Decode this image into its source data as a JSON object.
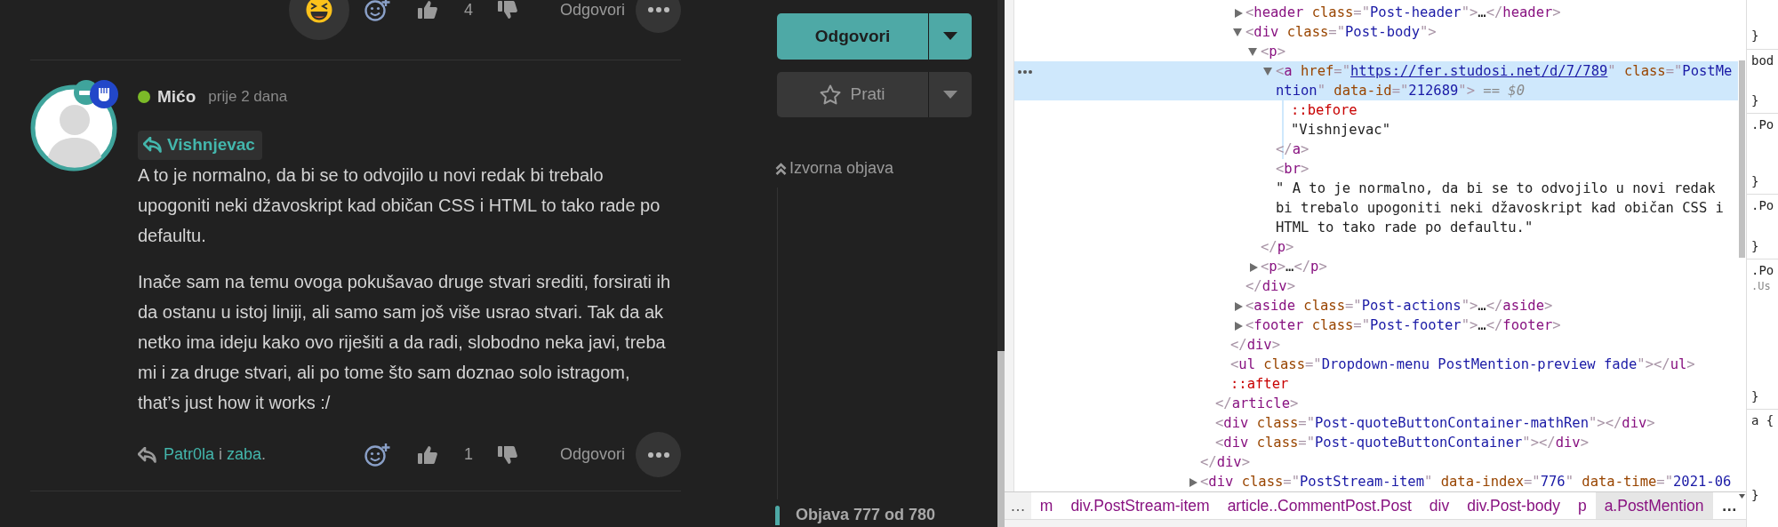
{
  "previous_post_footer": {
    "likes_count": "4",
    "reply_label": "Odgovori"
  },
  "post": {
    "author": "Mićo",
    "online": true,
    "time": "prije 2 dana",
    "mention": "Vishnjevac",
    "paragraphs": [
      "A to je normalno, da bi se to odvojilo u novi redak bi trebalo upogoniti neki džavoskript kad običan CSS i HTML to tako rade po defaultu.",
      "Inače sam na temu ovoga pokušavao druge stvari srediti, forsirati ih da ostanu u istoj liniji, ali samo sam još više usrao stvari. Tak da ak netko ima ideju kako ovo riješiti a da radi, slobodno neka javi, treba mi i za druge stvari, ali po tome što sam doznao solo istragom, that’s just how it works :/"
    ],
    "liked_by": [
      {
        "kind": "link",
        "text": "Patr0la"
      },
      {
        "kind": "text",
        "text": " i "
      },
      {
        "kind": "link",
        "text": "zaba"
      },
      {
        "kind": "text",
        "text": "."
      }
    ],
    "likes_count": "1",
    "reply_label": "Odgovori"
  },
  "sidebar": {
    "reply_button": "Odgovori",
    "follow_button": "Prati",
    "original_post_link": "Izvorna objava",
    "position": "Objava 777 od 780"
  },
  "devtools": {
    "tree": [
      {
        "children": [
          {
            "children": [
              {
                "children": [
                  {
                    "expanded": false,
                    "selected": false,
                    "open": [
                      {
                        "kind": "punct",
                        "text": "<"
                      },
                      {
                        "kind": "tag",
                        "text": "header"
                      },
                      {
                        "kind": "attr",
                        "text": " class"
                      },
                      {
                        "kind": "punct",
                        "text": "=\""
                      },
                      {
                        "kind": "value",
                        "text": "Post-header"
                      },
                      {
                        "kind": "punct",
                        "text": "\">"
                      },
                      {
                        "kind": "text",
                        "text": "…"
                      },
                      {
                        "kind": "punct",
                        "text": "</"
                      },
                      {
                        "kind": "tag",
                        "text": "header"
                      },
                      {
                        "kind": "punct",
                        "text": ">"
                      }
                    ]
                  },
                  {
                    "expanded": true,
                    "selected": false,
                    "open": [
                      {
                        "kind": "punct",
                        "text": "<"
                      },
                      {
                        "kind": "tag",
                        "text": "div"
                      },
                      {
                        "kind": "attr",
                        "text": " class"
                      },
                      {
                        "kind": "punct",
                        "text": "=\""
                      },
                      {
                        "kind": "value",
                        "text": "Post-body"
                      },
                      {
                        "kind": "punct",
                        "text": "\">"
                      }
                    ],
                    "children": [
                      {
                        "expanded": true,
                        "selected": false,
                        "open": [
                          {
                            "kind": "punct",
                            "text": "<"
                          },
                          {
                            "kind": "tag",
                            "text": "p"
                          },
                          {
                            "kind": "punct",
                            "text": ">"
                          }
                        ],
                        "children": [
                          {
                            "expanded": true,
                            "selected": true,
                            "open": [
                              {
                                "kind": "punct",
                                "text": "<"
                              },
                              {
                                "kind": "tag",
                                "text": "a"
                              },
                              {
                                "kind": "attr",
                                "text": " href"
                              },
                              {
                                "kind": "punct",
                                "text": "=\""
                              },
                              {
                                "kind": "link",
                                "text": "https://fer.studosi.net/d/7/789"
                              },
                              {
                                "kind": "punct",
                                "text": "\""
                              },
                              {
                                "kind": "attr",
                                "text": " class"
                              },
                              {
                                "kind": "punct",
                                "text": "=\""
                              },
                              {
                                "kind": "value",
                                "text": "PostMention"
                              },
                              {
                                "kind": "punct",
                                "text": "\""
                              },
                              {
                                "kind": "attr",
                                "text": " data-id"
                              },
                              {
                                "kind": "punct",
                                "text": "=\""
                              },
                              {
                                "kind": "value",
                                "text": "212689"
                              },
                              {
                                "kind": "punct",
                                "text": "\">"
                              }
                            ],
                            "ref": "== $0",
                            "children": [
                              {
                                "selected": false,
                                "open": [
                                  {
                                    "kind": "pseudo",
                                    "text": "::before"
                                  }
                                ]
                              },
                              {
                                "selected": false,
                                "open": [
                                  {
                                    "kind": "text",
                                    "text": "\"Vishnjevac\""
                                  }
                                ]
                              }
                            ],
                            "close": [
                              {
                                "kind": "punct",
                                "text": "</"
                              },
                              {
                                "kind": "tag",
                                "text": "a"
                              },
                              {
                                "kind": "punct",
                                "text": ">"
                              }
                            ]
                          },
                          {
                            "selected": false,
                            "open": [
                              {
                                "kind": "punct",
                                "text": "<"
                              },
                              {
                                "kind": "tag",
                                "text": "br"
                              },
                              {
                                "kind": "punct",
                                "text": ">"
                              }
                            ]
                          },
                          {
                            "selected": false,
                            "open": [
                              {
                                "kind": "text",
                                "text": "\" A to je normalno, da bi se to odvojilo u novi redak bi trebalo upogoniti neki džavoskript kad običan CSS i HTML to tako rade po defaultu.\""
                              }
                            ]
                          }
                        ],
                        "close": [
                          {
                            "kind": "punct",
                            "text": "</"
                          },
                          {
                            "kind": "tag",
                            "text": "p"
                          },
                          {
                            "kind": "punct",
                            "text": ">"
                          }
                        ]
                      },
                      {
                        "expanded": false,
                        "selected": false,
                        "open": [
                          {
                            "kind": "punct",
                            "text": "<"
                          },
                          {
                            "kind": "tag",
                            "text": "p"
                          },
                          {
                            "kind": "punct",
                            "text": ">"
                          },
                          {
                            "kind": "text",
                            "text": "…"
                          },
                          {
                            "kind": "punct",
                            "text": "</"
                          },
                          {
                            "kind": "tag",
                            "text": "p"
                          },
                          {
                            "kind": "punct",
                            "text": ">"
                          }
                        ]
                      }
                    ],
                    "close": [
                      {
                        "kind": "punct",
                        "text": "</"
                      },
                      {
                        "kind": "tag",
                        "text": "div"
                      },
                      {
                        "kind": "punct",
                        "text": ">"
                      }
                    ]
                  },
                  {
                    "expanded": false,
                    "selected": false,
                    "open": [
                      {
                        "kind": "punct",
                        "text": "<"
                      },
                      {
                        "kind": "tag",
                        "text": "aside"
                      },
                      {
                        "kind": "attr",
                        "text": " class"
                      },
                      {
                        "kind": "punct",
                        "text": "=\""
                      },
                      {
                        "kind": "value",
                        "text": "Post-actions"
                      },
                      {
                        "kind": "punct",
                        "text": "\">"
                      },
                      {
                        "kind": "text",
                        "text": "…"
                      },
                      {
                        "kind": "punct",
                        "text": "</"
                      },
                      {
                        "kind": "tag",
                        "text": "aside"
                      },
                      {
                        "kind": "punct",
                        "text": ">"
                      }
                    ]
                  },
                  {
                    "expanded": false,
                    "selected": false,
                    "open": [
                      {
                        "kind": "punct",
                        "text": "<"
                      },
                      {
                        "kind": "tag",
                        "text": "footer"
                      },
                      {
                        "kind": "attr",
                        "text": " class"
                      },
                      {
                        "kind": "punct",
                        "text": "=\""
                      },
                      {
                        "kind": "value",
                        "text": "Post-footer"
                      },
                      {
                        "kind": "punct",
                        "text": "\">"
                      },
                      {
                        "kind": "text",
                        "text": "…"
                      },
                      {
                        "kind": "punct",
                        "text": "</"
                      },
                      {
                        "kind": "tag",
                        "text": "footer"
                      },
                      {
                        "kind": "punct",
                        "text": ">"
                      }
                    ]
                  }
                ],
                "close": [
                  {
                    "kind": "punct",
                    "text": "</"
                  },
                  {
                    "kind": "tag",
                    "text": "div"
                  },
                  {
                    "kind": "punct",
                    "text": ">"
                  }
                ]
              },
              {
                "selected": false,
                "open": [
                  {
                    "kind": "punct",
                    "text": "<"
                  },
                  {
                    "kind": "tag",
                    "text": "ul"
                  },
                  {
                    "kind": "attr",
                    "text": " class"
                  },
                  {
                    "kind": "punct",
                    "text": "=\""
                  },
                  {
                    "kind": "value",
                    "text": "Dropdown-menu PostMention-preview fade"
                  },
                  {
                    "kind": "punct",
                    "text": "\"></"
                  },
                  {
                    "kind": "tag",
                    "text": "ul"
                  },
                  {
                    "kind": "punct",
                    "text": ">"
                  }
                ]
              },
              {
                "selected": false,
                "open": [
                  {
                    "kind": "pseudo",
                    "text": "::after"
                  }
                ]
              }
            ],
            "close": [
              {
                "kind": "punct",
                "text": "</"
              },
              {
                "kind": "tag",
                "text": "article"
              },
              {
                "kind": "punct",
                "text": ">"
              }
            ]
          },
          {
            "selected": false,
            "open": [
              {
                "kind": "punct",
                "text": "<"
              },
              {
                "kind": "tag",
                "text": "div"
              },
              {
                "kind": "attr",
                "text": " class"
              },
              {
                "kind": "punct",
                "text": "=\""
              },
              {
                "kind": "value",
                "text": "Post-quoteButtonContainer-mathRen"
              },
              {
                "kind": "punct",
                "text": "\"></"
              },
              {
                "kind": "tag",
                "text": "div"
              },
              {
                "kind": "punct",
                "text": ">"
              }
            ]
          },
          {
            "selected": false,
            "open": [
              {
                "kind": "punct",
                "text": "<"
              },
              {
                "kind": "tag",
                "text": "div"
              },
              {
                "kind": "attr",
                "text": " class"
              },
              {
                "kind": "punct",
                "text": "=\""
              },
              {
                "kind": "value",
                "text": "Post-quoteButtonContainer"
              },
              {
                "kind": "punct",
                "text": "\"></"
              },
              {
                "kind": "tag",
                "text": "div"
              },
              {
                "kind": "punct",
                "text": ">"
              }
            ]
          }
        ],
        "close": [
          {
            "kind": "punct",
            "text": "</"
          },
          {
            "kind": "tag",
            "text": "div"
          },
          {
            "kind": "punct",
            "text": ">"
          }
        ]
      },
      {
        "expanded": false,
        "selected": false,
        "open": [
          {
            "kind": "punct",
            "text": "<"
          },
          {
            "kind": "tag",
            "text": "div"
          },
          {
            "kind": "attr",
            "text": " class"
          },
          {
            "kind": "punct",
            "text": "=\""
          },
          {
            "kind": "value",
            "text": "PostStream-item"
          },
          {
            "kind": "punct",
            "text": "\""
          },
          {
            "kind": "attr",
            "text": " data-index"
          },
          {
            "kind": "punct",
            "text": "=\""
          },
          {
            "kind": "value",
            "text": "776"
          },
          {
            "kind": "punct",
            "text": "\""
          },
          {
            "kind": "attr",
            "text": " data-time"
          },
          {
            "kind": "punct",
            "text": "=\""
          },
          {
            "kind": "value",
            "text": "2021-06"
          }
        ]
      }
    ],
    "breadcrumb_scroll_left": "…",
    "breadcrumbs": [
      {
        "label": "m",
        "selected": false
      },
      {
        "label": "div.PostStream-item",
        "selected": false
      },
      {
        "label": "article..CommentPost.Post",
        "selected": false
      },
      {
        "label": "div",
        "selected": false
      },
      {
        "label": "div.Post-body",
        "selected": false
      },
      {
        "label": "p",
        "selected": false
      },
      {
        "label": "a.PostMention",
        "selected": true
      }
    ],
    "breadcrumb_scroll_right": "…",
    "style_rules": [
      {
        "close": "}"
      },
      {
        "selector": "bod",
        "close": "}"
      },
      {
        "selector": ".Po",
        "close": "}"
      },
      {
        "selector": ".Po",
        "close": "}"
      },
      {
        "selector": ".Po",
        "subselector": ".Us",
        "close": "}"
      },
      {
        "selector": "a {",
        "close": "}"
      }
    ]
  }
}
